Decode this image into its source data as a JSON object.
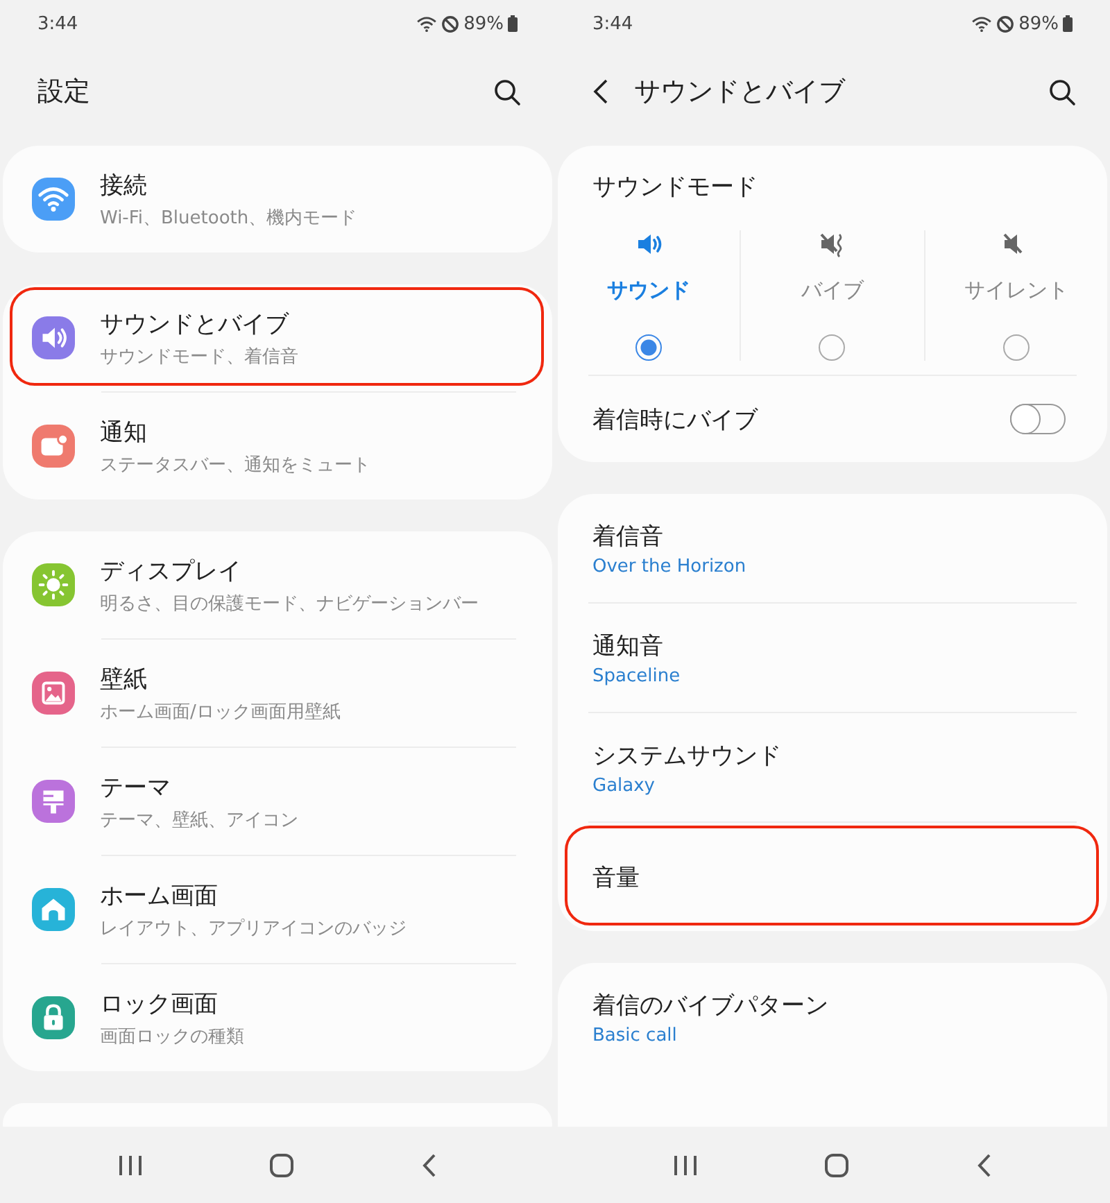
{
  "settings_screen": {
    "status_bar": {
      "time": "3:44",
      "battery": "89%"
    },
    "header": {
      "title": "設定"
    },
    "groups": [
      {
        "items": [
          {
            "title": "接続",
            "subtitle": "Wi-Fi、Bluetooth、機内モード",
            "color": "#4b9ef6",
            "highlighted": false
          }
        ]
      },
      {
        "items": [
          {
            "title": "サウンドとバイブ",
            "subtitle": "サウンドモード、着信音",
            "color": "#8a7be8",
            "highlighted": true
          },
          {
            "title": "通知",
            "subtitle": "ステータスバー、通知をミュート",
            "color": "#ef7a6e",
            "highlighted": false
          }
        ]
      },
      {
        "items": [
          {
            "title": "ディスプレイ",
            "subtitle": "明るさ、目の保護モード、ナビゲーションバー",
            "color": "#86c531",
            "highlighted": false
          },
          {
            "title": "壁紙",
            "subtitle": "ホーム画面/ロック画面用壁紙",
            "color": "#e5648a",
            "highlighted": false
          },
          {
            "title": "テーマ",
            "subtitle": "テーマ、壁紙、アイコン",
            "color": "#bb72dc",
            "highlighted": false
          },
          {
            "title": "ホーム画面",
            "subtitle": "レイアウト、アプリアイコンのバッジ",
            "color": "#27b3d8",
            "highlighted": false
          },
          {
            "title": "ロック画面",
            "subtitle": "画面ロックの種類",
            "color": "#27a68f",
            "highlighted": false
          }
        ]
      }
    ]
  },
  "sound_screen": {
    "status_bar": {
      "time": "3:44",
      "battery": "89%"
    },
    "header": {
      "title": "サウンドとバイブ"
    },
    "sound_mode": {
      "title": "サウンドモード",
      "options": [
        {
          "label": "サウンド",
          "selected": true
        },
        {
          "label": "バイブ",
          "selected": false
        },
        {
          "label": "サイレント",
          "selected": false
        }
      ]
    },
    "vibrate_on_call": {
      "label": "着信時にバイブ",
      "on": false
    },
    "items": [
      {
        "title": "着信音",
        "value": "Over the Horizon",
        "highlighted": false
      },
      {
        "title": "通知音",
        "value": "Spaceline",
        "highlighted": false
      },
      {
        "title": "システムサウンド",
        "value": "Galaxy",
        "highlighted": false
      },
      {
        "title": "音量",
        "highlighted": true
      }
    ],
    "next_items": [
      {
        "title": "着信のバイブパターン",
        "value": "Basic call",
        "highlighted": false
      }
    ]
  }
}
